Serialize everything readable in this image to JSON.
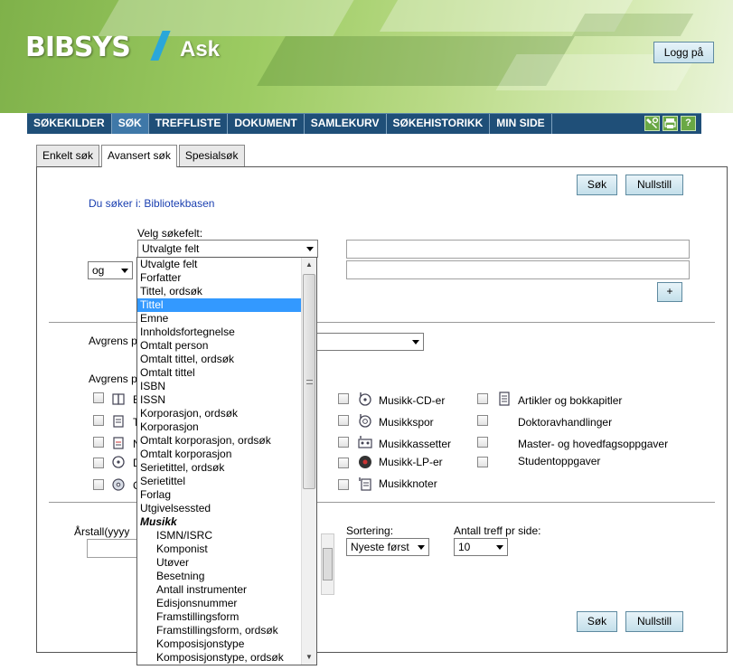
{
  "header": {
    "logo_brand": "BIBSYS",
    "logo_product": "Ask",
    "login_label": "Logg på"
  },
  "nav": {
    "items": [
      {
        "label": "SØKEKILDER",
        "active": false
      },
      {
        "label": "SØK",
        "active": true
      },
      {
        "label": "TREFFLISTE",
        "active": false
      },
      {
        "label": "DOKUMENT",
        "active": false
      },
      {
        "label": "SAMLEKURV",
        "active": false
      },
      {
        "label": "SØKEHISTORIKK",
        "active": false
      },
      {
        "label": "MIN SIDE",
        "active": false
      }
    ],
    "icons": [
      "tools-icon",
      "print-icon",
      "help-icon"
    ],
    "help_glyph": "?"
  },
  "tabs": [
    {
      "label": "Enkelt søk",
      "active": false
    },
    {
      "label": "Avansert søk",
      "active": true
    },
    {
      "label": "Spesialsøk",
      "active": false
    }
  ],
  "buttons": {
    "search": "Søk",
    "reset": "Nullstill",
    "add_row": "+"
  },
  "source": {
    "prefix": "Du søker i:",
    "name": "Bibliotekbasen"
  },
  "fields": {
    "select_label": "Velg søkefelt:",
    "select_value": "Utvalgte felt",
    "operator_value": "og"
  },
  "limits": {
    "avgrens_1_partial": "Avgrens p",
    "avgrens_2_partial": "Avgrens p"
  },
  "materials_left_partial": [
    {
      "icon": "book-icon",
      "label": "B"
    },
    {
      "icon": "periodical-icon",
      "label": "T"
    },
    {
      "icon": "notes-icon",
      "label": "N"
    },
    {
      "icon": "disc-icon",
      "label": "D"
    },
    {
      "icon": "cd-icon",
      "label": "C"
    }
  ],
  "materials_middle": [
    {
      "icon": "music-cd-icon",
      "label": "Musikk-CD-er"
    },
    {
      "icon": "music-track-icon",
      "label": "Musikkspor"
    },
    {
      "icon": "cassette-icon",
      "label": "Musikkassetter"
    },
    {
      "icon": "vinyl-icon",
      "label": "Musikk-LP-er"
    },
    {
      "icon": "sheet-music-icon",
      "label": "Musikknoter"
    }
  ],
  "materials_right": [
    {
      "icon": "article-icon",
      "label": "Artikler og bokkapitler"
    },
    {
      "icon": "",
      "label": "Doktoravhandlinger"
    },
    {
      "icon": "",
      "label": "Master- og hovedfagsoppgaver"
    },
    {
      "icon": "",
      "label": "Studentoppgaver"
    }
  ],
  "bottom": {
    "year_label": "Årstall(yyyy",
    "sort_label": "Sortering:",
    "sort_value": "Nyeste først",
    "per_page_label": "Antall treff pr side:",
    "per_page_value": "10"
  },
  "dropdown": {
    "items": [
      {
        "label": "Utvalgte felt",
        "kind": "normal"
      },
      {
        "label": "Forfatter",
        "kind": "normal"
      },
      {
        "label": "Tittel, ordsøk",
        "kind": "normal"
      },
      {
        "label": "Tittel",
        "kind": "selected"
      },
      {
        "label": "Emne",
        "kind": "normal"
      },
      {
        "label": "Innholdsfortegnelse",
        "kind": "normal"
      },
      {
        "label": "Omtalt person",
        "kind": "normal"
      },
      {
        "label": "Omtalt tittel, ordsøk",
        "kind": "normal"
      },
      {
        "label": "Omtalt tittel",
        "kind": "normal"
      },
      {
        "label": "ISBN",
        "kind": "normal"
      },
      {
        "label": "ISSN",
        "kind": "normal"
      },
      {
        "label": "Korporasjon, ordsøk",
        "kind": "normal"
      },
      {
        "label": "Korporasjon",
        "kind": "normal"
      },
      {
        "label": "Omtalt korporasjon, ordsøk",
        "kind": "normal"
      },
      {
        "label": "Omtalt korporasjon",
        "kind": "normal"
      },
      {
        "label": "Serietittel, ordsøk",
        "kind": "normal"
      },
      {
        "label": "Serietittel",
        "kind": "normal"
      },
      {
        "label": "Forlag",
        "kind": "normal"
      },
      {
        "label": "Utgivelsessted",
        "kind": "normal"
      },
      {
        "label": "Musikk",
        "kind": "group"
      },
      {
        "label": "ISMN/ISRC",
        "kind": "sub"
      },
      {
        "label": "Komponist",
        "kind": "sub"
      },
      {
        "label": "Utøver",
        "kind": "sub"
      },
      {
        "label": "Besetning",
        "kind": "sub"
      },
      {
        "label": "Antall instrumenter",
        "kind": "sub"
      },
      {
        "label": "Edisjonsnummer",
        "kind": "sub"
      },
      {
        "label": "Framstillingsform",
        "kind": "sub"
      },
      {
        "label": "Framstillingsform, ordsøk",
        "kind": "sub"
      },
      {
        "label": "Komposisjonstype",
        "kind": "sub"
      },
      {
        "label": "Komposisjonstype, ordsøk",
        "kind": "sub"
      }
    ]
  },
  "colors": {
    "nav_bg": "#1f4f78",
    "nav_active": "#3f78a8",
    "link_blue": "#1a3fb0",
    "selection": "#3399ff",
    "banner_green": "#9ccb62"
  }
}
